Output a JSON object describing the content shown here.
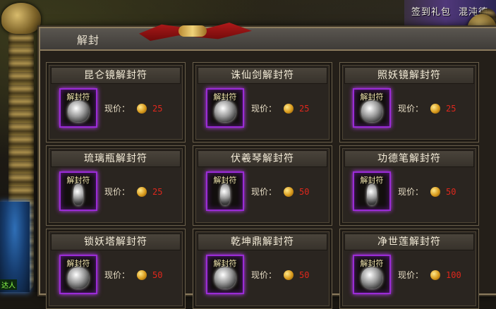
{
  "top_links": [
    "签到礼包",
    "混沌德"
  ],
  "window": {
    "title": "解封"
  },
  "price_label": "现价：",
  "slot_label": "解封符",
  "items": [
    {
      "name": "昆仑镜解封符",
      "price": "25",
      "icon": "mirror-icon"
    },
    {
      "name": "诛仙剑解封符",
      "price": "25",
      "icon": "demon-mask-icon"
    },
    {
      "name": "照妖镜解封符",
      "price": "25",
      "icon": "winged-emblem-icon"
    },
    {
      "name": "琉璃瓶解封符",
      "price": "25",
      "icon": "vase-icon"
    },
    {
      "name": "伏羲琴解封符",
      "price": "50",
      "icon": "zither-icon"
    },
    {
      "name": "功德笔解封符",
      "price": "50",
      "icon": "brush-icon"
    },
    {
      "name": "锁妖塔解封符",
      "price": "50",
      "icon": "tower-icon"
    },
    {
      "name": "乾坤鼎解封符",
      "price": "50",
      "icon": "cauldron-icon"
    },
    {
      "name": "净世莲解封符",
      "price": "100",
      "icon": "lotus-icon"
    }
  ],
  "avatar_tag": "达人"
}
